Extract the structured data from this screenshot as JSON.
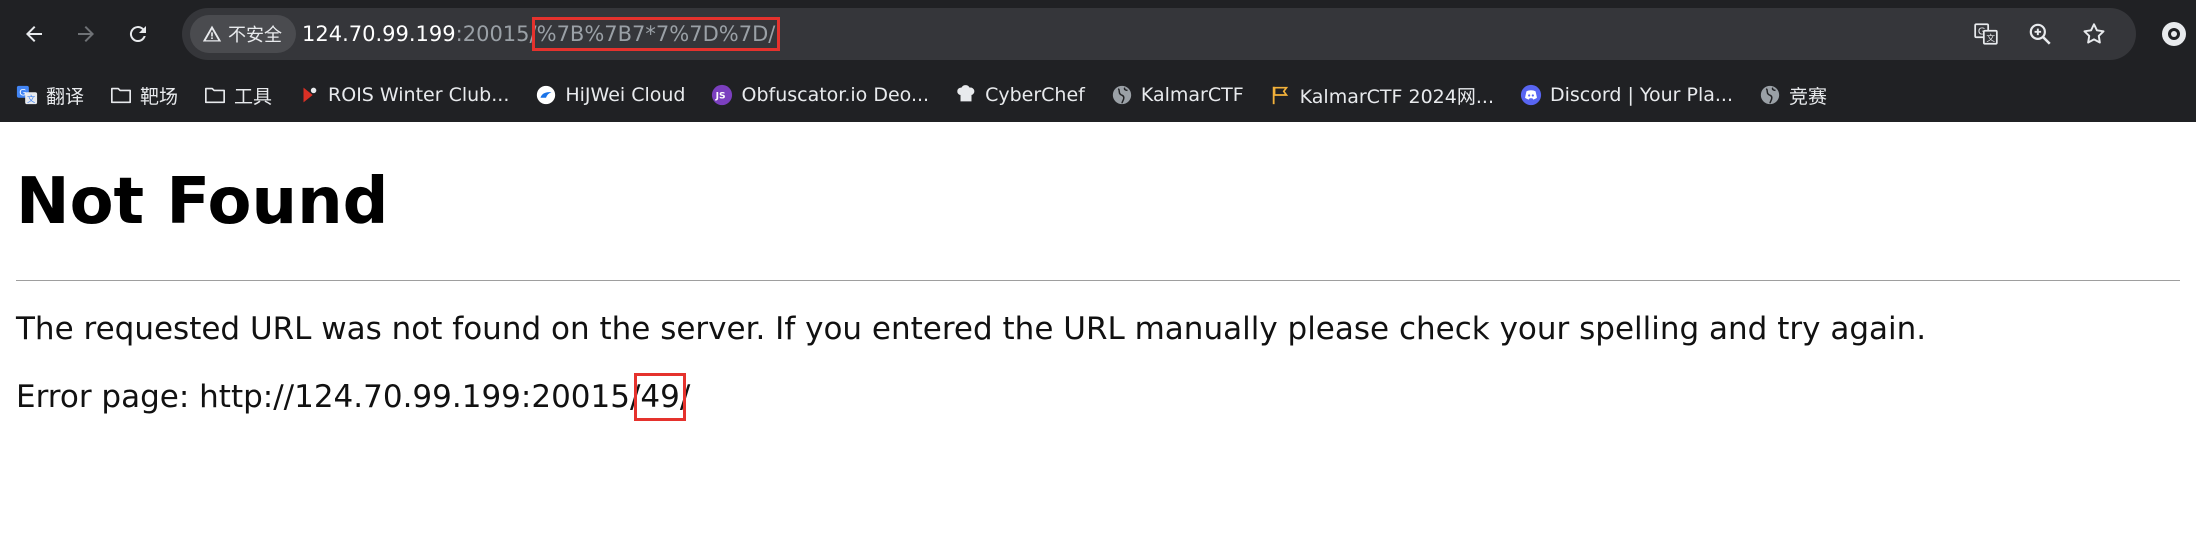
{
  "browser": {
    "security_label": "不安全",
    "url": {
      "host": "124.70.99.199",
      "port": ":20015",
      "slash": "/",
      "path": "%7B%7B7*7%7D%7D/"
    },
    "bookmarks": [
      {
        "label": "翻译",
        "icon": "translate-icon"
      },
      {
        "label": "靶场",
        "icon": "folder-icon"
      },
      {
        "label": "工具",
        "icon": "folder-icon"
      },
      {
        "label": "ROIS Winter Club...",
        "icon": "rois-icon"
      },
      {
        "label": "HiJWei Cloud",
        "icon": "cloud-icon"
      },
      {
        "label": "Obfuscator.io Deo...",
        "icon": "js-icon"
      },
      {
        "label": "CyberChef",
        "icon": "chef-icon"
      },
      {
        "label": "KalmarCTF",
        "icon": "globe-icon"
      },
      {
        "label": "KalmarCTF 2024网...",
        "icon": "flag-icon"
      },
      {
        "label": "Discord | Your Pla...",
        "icon": "discord-icon"
      },
      {
        "label": "竞赛",
        "icon": "globe-icon"
      }
    ]
  },
  "page": {
    "title": "Not Found",
    "message": "The requested URL was not found on the server. If you entered the URL manually please check your spelling and try again.",
    "error_prefix": "Error page: http://124.70.99.199:20015/",
    "error_value": "49",
    "error_suffix": "/"
  }
}
